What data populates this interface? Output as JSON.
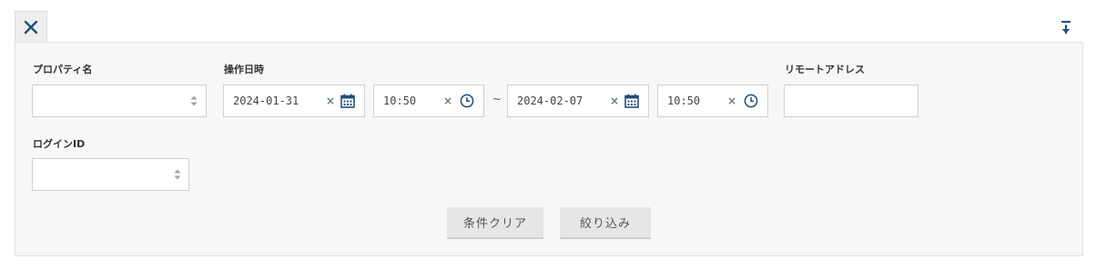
{
  "toolbar": {
    "close_icon": "close-icon",
    "collapse_icon": "collapse-to-top-icon"
  },
  "filters": {
    "property": {
      "label": "プロパティ名",
      "value": ""
    },
    "operation_datetime": {
      "label": "操作日時",
      "from_date": "2024-01-31",
      "from_time": "10:50",
      "separator": "~",
      "to_date": "2024-02-07",
      "to_time": "10:50",
      "clear_symbol": "×"
    },
    "remote_address": {
      "label": "リモートアドレス",
      "value": ""
    },
    "login_id": {
      "label": "ログインID",
      "value": ""
    }
  },
  "actions": {
    "clear_label": "条件クリア",
    "filter_label": "絞り込み"
  },
  "colors": {
    "accent": "#1f4e79",
    "panel_bg": "#f7f7f7",
    "button_bg": "#e6e6e6"
  }
}
